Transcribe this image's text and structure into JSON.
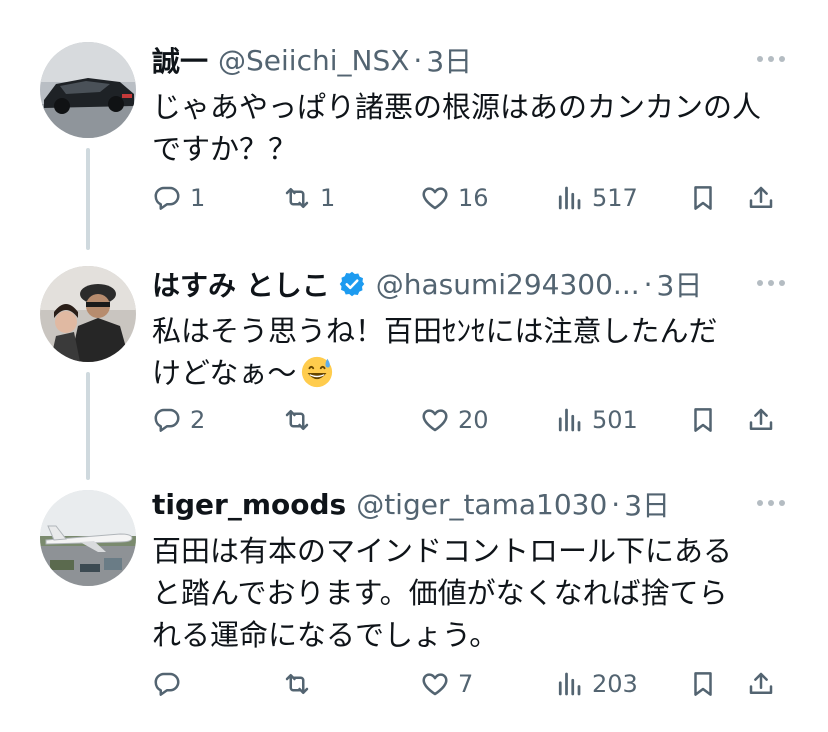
{
  "tweets": [
    {
      "display_name": "誠一",
      "handle": "@Seiichi_NSX",
      "separator": "·",
      "time": "3日",
      "verified": false,
      "text": "じゃあやっぱり諸悪の根源はあのカンカンの人\nですか？？",
      "counts": {
        "replies": "1",
        "reposts": "1",
        "likes": "16",
        "views": "517"
      }
    },
    {
      "display_name": "はすみ としこ",
      "handle": "@hasumi294300...",
      "separator": "·",
      "time": "3日",
      "verified": true,
      "text": "私はそう思うね！百田ｾﾝｾには注意したんだ\nけどなぁ〜",
      "counts": {
        "replies": "2",
        "reposts": "",
        "likes": "20",
        "views": "501"
      }
    },
    {
      "display_name": "tiger_moods",
      "handle": "@tiger_tama1030",
      "separator": "·",
      "time": "3日",
      "verified": false,
      "text": "百田は有本のマインドコントロール下にある\nと踏んでおります。価値がなくなれば捨てら\nれる運命になるでしょう。",
      "counts": {
        "replies": "",
        "reposts": "",
        "likes": "7",
        "views": "203"
      }
    }
  ],
  "colors": {
    "text": "#0f1419",
    "secondary": "#536471",
    "verified": "#1d9bf0",
    "thread_line": "#cfd9de"
  },
  "icons": [
    "reply-icon",
    "repost-icon",
    "like-icon",
    "views-icon",
    "bookmark-icon",
    "share-icon",
    "more-icon",
    "verified-badge-icon",
    "grinning-sweat-emoji"
  ]
}
